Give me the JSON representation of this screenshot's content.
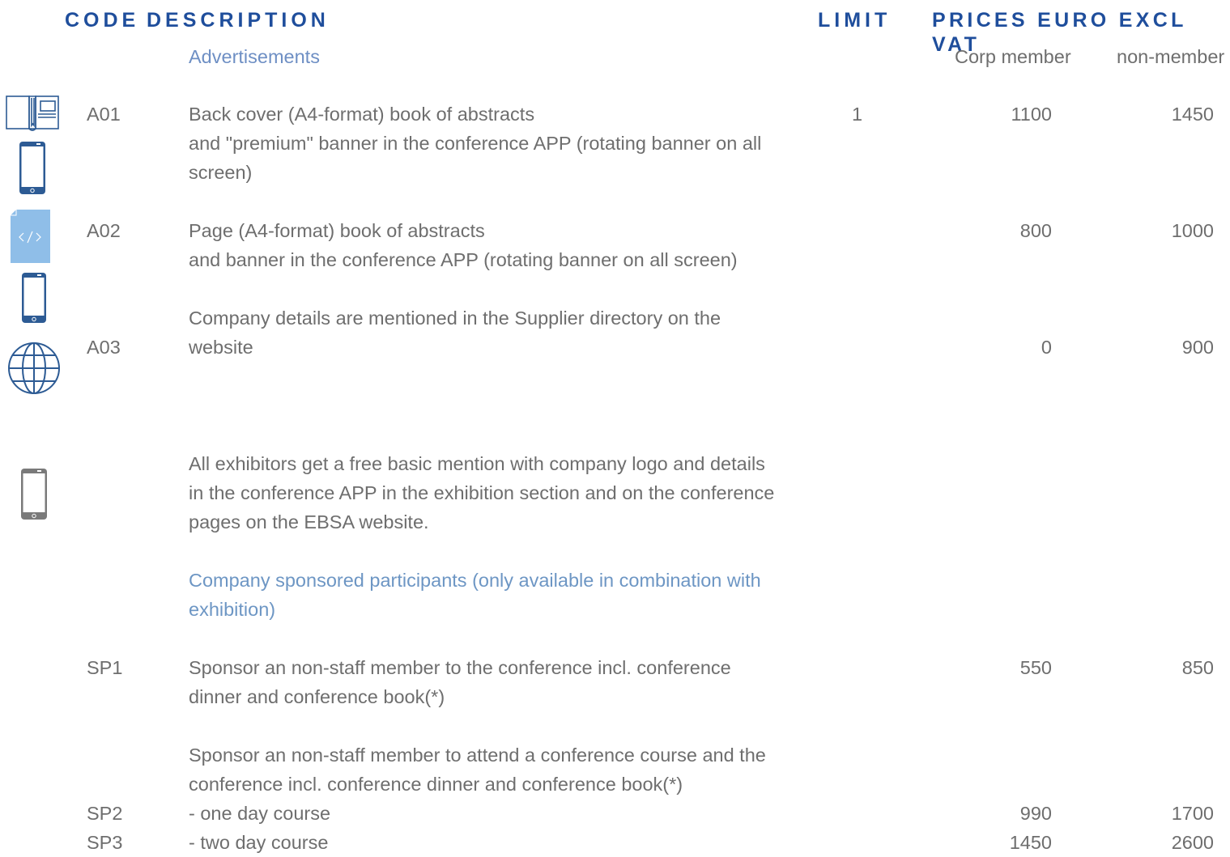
{
  "header": {
    "code": "CODE",
    "description": "DESCRIPTION",
    "limit": "LIMIT",
    "prices": "PRICES EURO EXCL VAT"
  },
  "subheader": {
    "section": "Advertisements",
    "corp_member": "Corp member",
    "non_member": "non-member"
  },
  "rows": [
    {
      "code": "A01",
      "description": [
        "Back cover (A4-format) book of abstracts",
        "and \"premium\" banner in the conference APP (rotating banner on all",
        "screen)"
      ],
      "limit": "1",
      "corp": "1100",
      "non": "1450",
      "icons": [
        "book-icon",
        "phone-icon"
      ]
    },
    {
      "code": "A02",
      "description": [
        "Page (A4-format) book of abstracts",
        "and banner in the conference APP (rotating banner on all screen)"
      ],
      "limit": "",
      "corp": "800",
      "non": "1000",
      "icons": [
        "code-page-icon",
        "phone-icon"
      ]
    },
    {
      "code": "A03",
      "description": [
        "Company details are mentioned in the Supplier directory on the",
        "website"
      ],
      "limit": "",
      "corp": "0",
      "non": "900",
      "icons": [
        "globe-icon"
      ]
    }
  ],
  "note": {
    "lines": [
      "All exhibitors get a free basic mention with company logo and details",
      "in the conference APP in the exhibition section and on the conference",
      "pages on the EBSA website."
    ],
    "icon": "phone-icon"
  },
  "section2": {
    "title": [
      "Company sponsored participants (only available in combination with",
      "exhibition)"
    ]
  },
  "sp_rows": [
    {
      "code": "SP1",
      "description": [
        "Sponsor an non-staff member to the conference incl. conference",
        "dinner and conference book(*)"
      ],
      "corp": "550",
      "non": "850"
    }
  ],
  "sp_intro": [
    "Sponsor an non-staff member to attend a conference course  and the",
    "conference incl. conference dinner and conference book(*)"
  ],
  "sp_course_rows": [
    {
      "code": "SP2",
      "description": "- one day course",
      "corp": "990",
      "non": "1700"
    },
    {
      "code": "SP3",
      "description": "- two day course",
      "corp": "1450",
      "non": "2600"
    }
  ],
  "colors": {
    "header": "#1f4e9c",
    "section": "#6e8fc4",
    "text": "#6e6e6e",
    "icon_dark": "#2d5b94",
    "icon_light": "#8fbee8",
    "icon_gray": "#7a7a7a"
  }
}
